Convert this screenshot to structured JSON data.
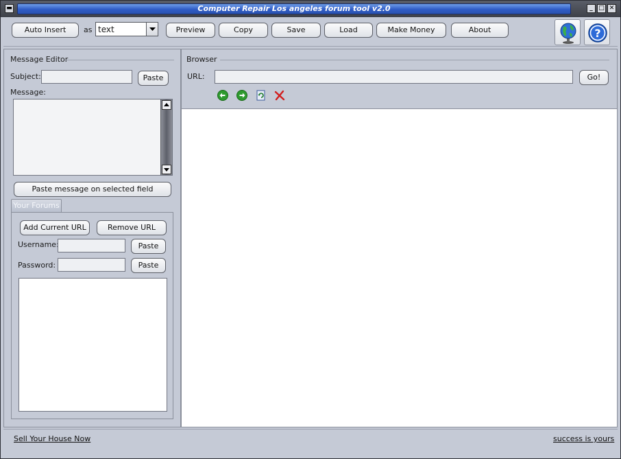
{
  "window": {
    "title": "Computer Repair Los angeles forum tool v2.0",
    "controls": {
      "menu": "▬",
      "minimize": "_",
      "maximize": "□",
      "close": "✕"
    }
  },
  "toolbar": {
    "auto_insert": "Auto Insert",
    "as_label": "as",
    "format_value": "text",
    "preview": "Preview",
    "copy": "Copy",
    "save": "Save",
    "load": "Load",
    "make_money": "Make Money",
    "about": "About"
  },
  "icons": {
    "globe": "globe-icon",
    "help": "help-icon",
    "back": "back-arrow-icon",
    "forward": "forward-arrow-icon",
    "refresh": "refresh-icon",
    "stop": "stop-icon"
  },
  "editor": {
    "section_title": "Message Editor",
    "subject_label": "Subject:",
    "subject_value": "",
    "paste": "Paste",
    "message_label": "Message:",
    "message_value": "",
    "paste_message": "Paste message on selected field"
  },
  "forums": {
    "tab_label": "Your Forums",
    "add_url": "Add Current URL",
    "remove_url": "Remove URL",
    "username_label": "Username:",
    "username_value": "",
    "password_label": "Password:",
    "password_value": "",
    "paste": "Paste",
    "urls": []
  },
  "browser": {
    "section_title": "Browser",
    "url_label": "URL:",
    "url_value": "",
    "go": "Go!"
  },
  "footer": {
    "left_link": "Sell Your House Now",
    "right_link": "success is yours"
  },
  "colors": {
    "window_bg": "#c5cad6",
    "title_blue": "#2f5cc6",
    "stop_red": "#d11d1d",
    "nav_green": "#2e9a2e"
  }
}
